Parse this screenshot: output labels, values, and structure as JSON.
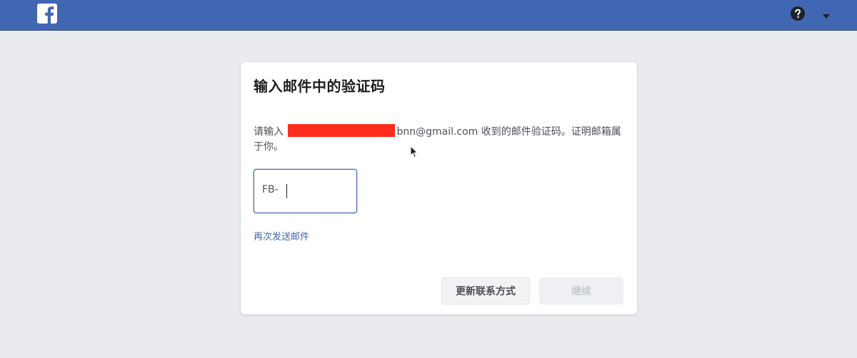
{
  "header": {
    "logo_icon": "facebook-f-icon",
    "help_icon": "help-question-icon",
    "menu_icon": "caret-down-icon",
    "bar_color": "#4267b2"
  },
  "dialog": {
    "title": "输入邮件中的验证码",
    "description_prefix": "请输入",
    "description_email_suffix": "bnn@gmail.com",
    "description_suffix": " 收到的邮件验证码。证明邮箱属于你。",
    "code_prefix": "FB-",
    "code_value": "",
    "resend_label": "再次发送邮件",
    "change_contact_label": "更新联系方式",
    "continue_label": "继续"
  }
}
